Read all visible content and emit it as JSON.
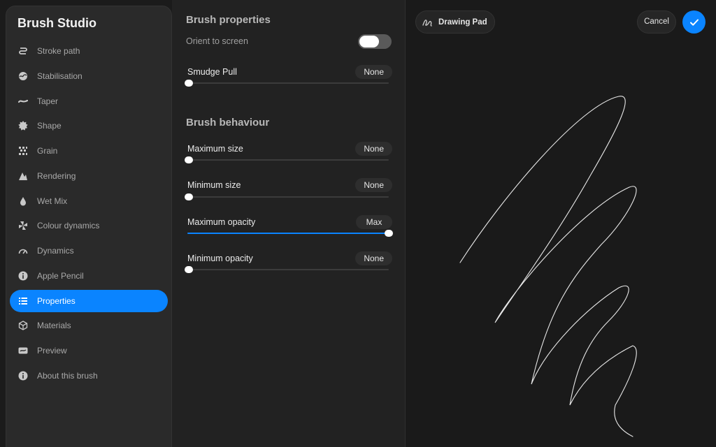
{
  "app": {
    "title": "Brush Studio"
  },
  "sidebar": {
    "items": [
      {
        "label": "Stroke path",
        "icon": "stroke-path-icon",
        "active": false
      },
      {
        "label": "Stabilisation",
        "icon": "stabilisation-icon",
        "active": false
      },
      {
        "label": "Taper",
        "icon": "taper-icon",
        "active": false
      },
      {
        "label": "Shape",
        "icon": "shape-icon",
        "active": false
      },
      {
        "label": "Grain",
        "icon": "grain-icon",
        "active": false
      },
      {
        "label": "Rendering",
        "icon": "rendering-icon",
        "active": false
      },
      {
        "label": "Wet Mix",
        "icon": "wet-mix-icon",
        "active": false
      },
      {
        "label": "Colour dynamics",
        "icon": "colour-dynamics-icon",
        "active": false
      },
      {
        "label": "Dynamics",
        "icon": "dynamics-icon",
        "active": false
      },
      {
        "label": "Apple Pencil",
        "icon": "info-icon",
        "active": false
      },
      {
        "label": "Properties",
        "icon": "list-icon",
        "active": true
      },
      {
        "label": "Materials",
        "icon": "cube-icon",
        "active": false
      },
      {
        "label": "Preview",
        "icon": "preview-icon",
        "active": false
      },
      {
        "label": "About this brush",
        "icon": "info-icon",
        "active": false
      }
    ]
  },
  "properties": {
    "brush_properties_title": "Brush properties",
    "orient_label": "Orient to screen",
    "orient_enabled": false,
    "smudge": {
      "label": "Smudge Pull",
      "value": "None",
      "level": 0
    },
    "brush_behaviour_title": "Brush behaviour",
    "max_size": {
      "label": "Maximum size",
      "value": "None",
      "level": 0
    },
    "min_size": {
      "label": "Minimum size",
      "value": "None",
      "level": 0
    },
    "max_opacity": {
      "label": "Maximum opacity",
      "value": "Max",
      "level": 1
    },
    "min_opacity": {
      "label": "Minimum opacity",
      "value": "None",
      "level": 0
    }
  },
  "canvas": {
    "drawing_pad_label": "Drawing Pad",
    "cancel_label": "Cancel",
    "accent_color": "#0a84ff"
  }
}
